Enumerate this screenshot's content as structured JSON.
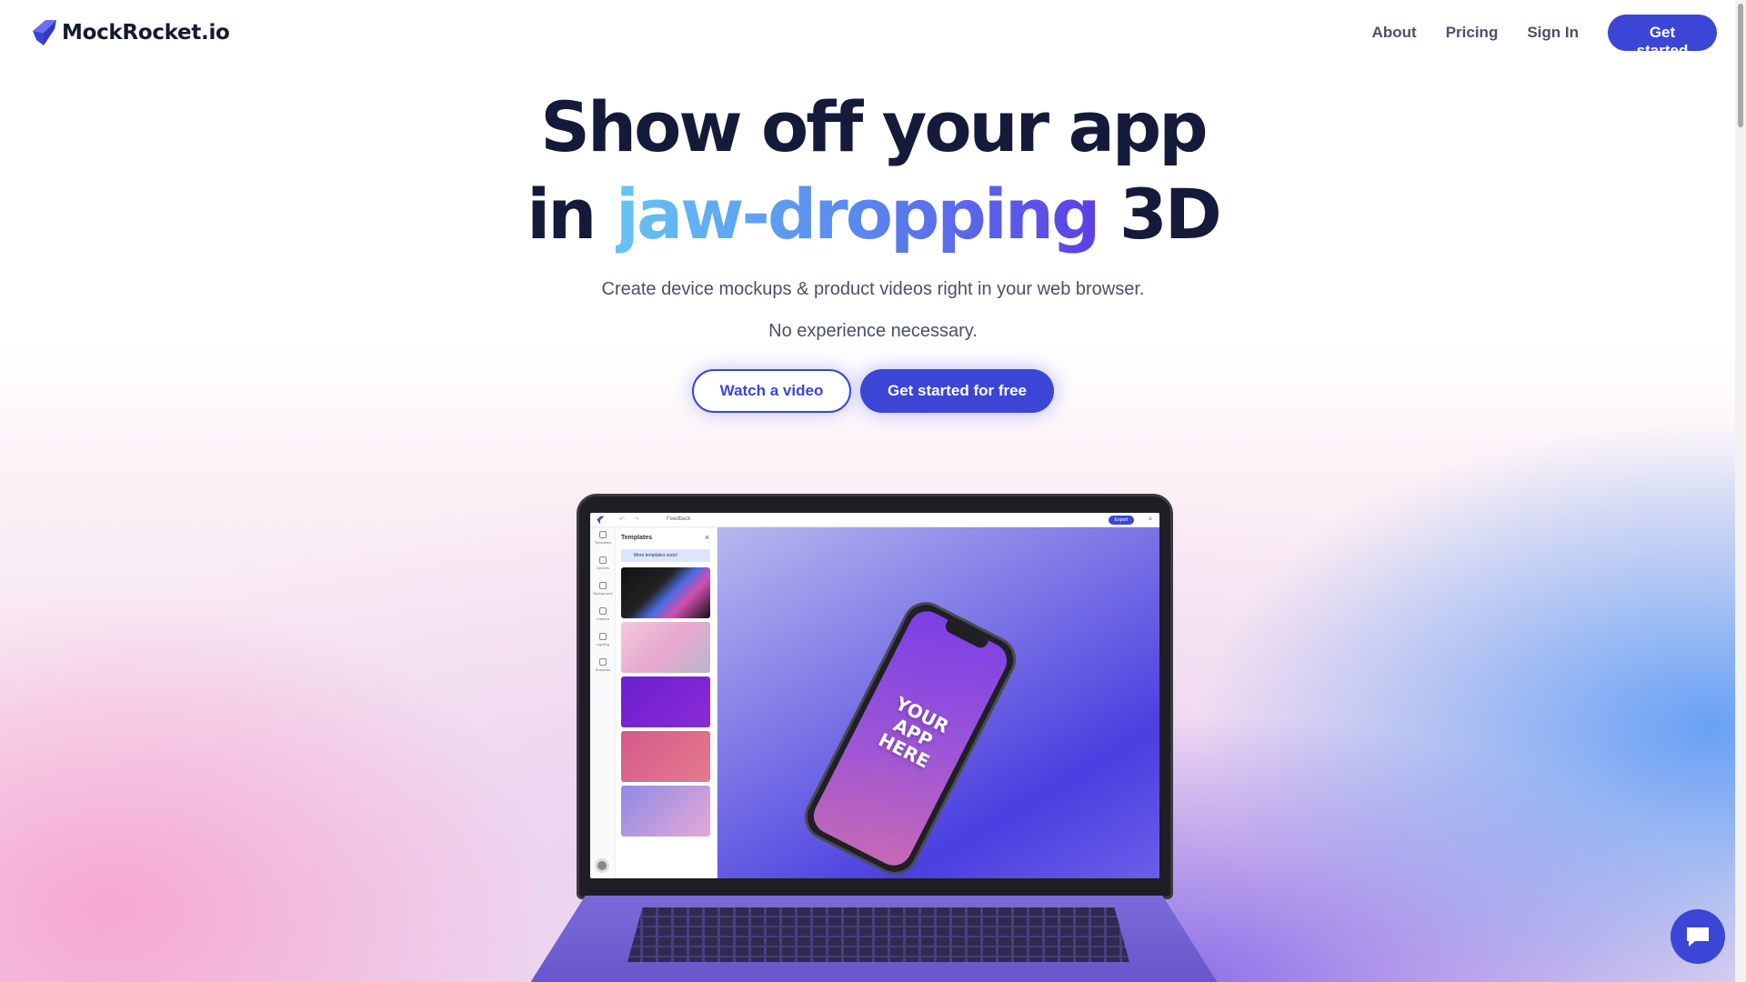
{
  "nav": {
    "brand": "MockRocket.io",
    "links": [
      "About",
      "Pricing",
      "Sign In"
    ],
    "cta": "Get started"
  },
  "hero": {
    "line1": "Show off your app",
    "line2_start": "in ",
    "line2_highlight": "jaw-dropping",
    "line2_end": " 3D",
    "subtitle": "Create device mockups & product videos right in your web browser.",
    "subtitle2": "No experience necessary.",
    "secondary_cta": "Watch a video",
    "primary_cta": "Get started for free"
  },
  "app_preview": {
    "toolbar_label": "Feedback",
    "export_label": "Export",
    "panel_title": "Templates",
    "panel_note": "More templates soon!",
    "rail_items": [
      "Templates",
      "Devices",
      "Background",
      "Camera",
      "Lighting",
      "Shadows"
    ],
    "phone_text_1": "YOUR",
    "phone_text_2": "APP",
    "phone_text_3": "HERE"
  },
  "colors": {
    "accent": "#3b46d6",
    "heading": "#141a3a",
    "body_text": "#4a5068"
  },
  "icons": {
    "logo": "rocket-logo-icon",
    "chat": "chat-bubble-icon"
  }
}
